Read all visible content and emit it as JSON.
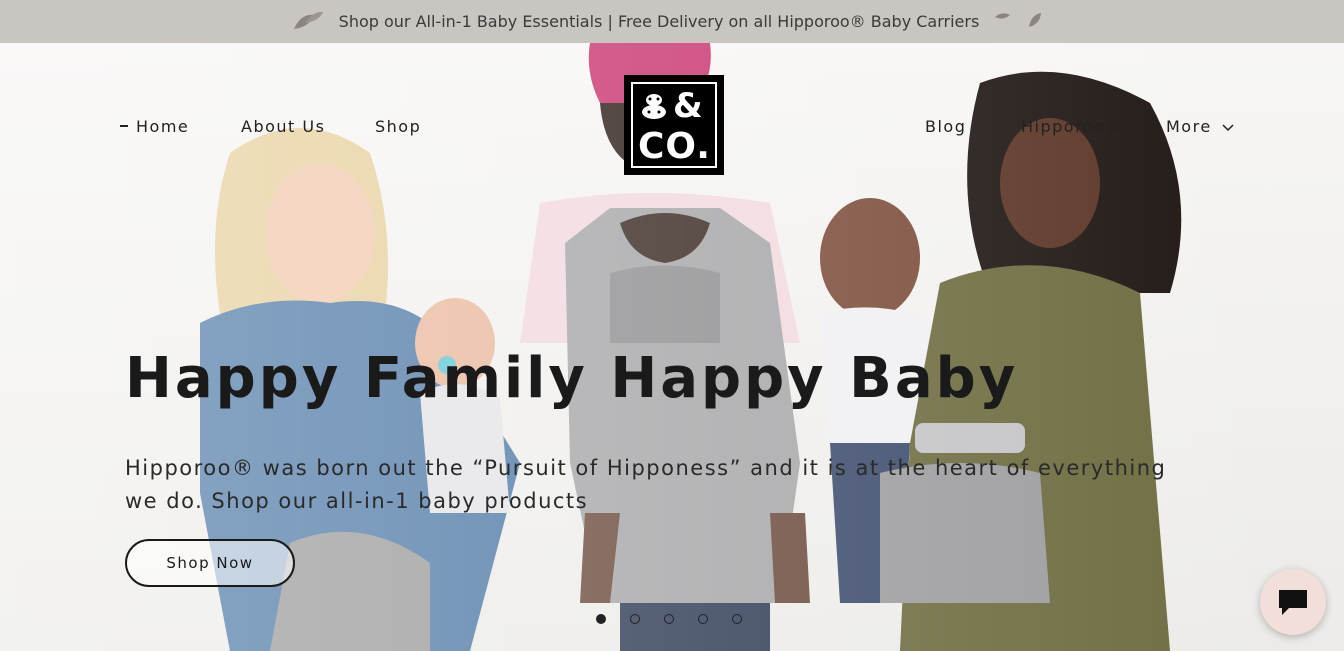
{
  "announcement": {
    "text": "Shop our All-in-1 Baby Essentials | Free Delivery on all Hipporoo® Baby Carriers",
    "left_icon": "leaf-icon",
    "right_icon": "leaf-icon"
  },
  "nav": {
    "left": [
      {
        "label": "Home",
        "active": true
      },
      {
        "label": "About Us"
      },
      {
        "label": "Shop"
      }
    ],
    "right": [
      {
        "label": "Blog"
      },
      {
        "label": "Hipporoo®"
      },
      {
        "label": "More"
      }
    ],
    "more_icon": "chevron-down-icon"
  },
  "logo": {
    "line1": "&",
    "line2": "CO."
  },
  "hero": {
    "headline": "Happy Family Happy Baby",
    "subcopy": "Hipporoo® was born out the “Pursuit of Hipponess” and it is at the heart of everything we do. Shop our all-in-1 baby products",
    "cta_label": "Shop Now"
  },
  "carousel": {
    "slides": 5,
    "active_index": 0
  },
  "chat": {
    "icon": "chat-bubble-icon"
  }
}
